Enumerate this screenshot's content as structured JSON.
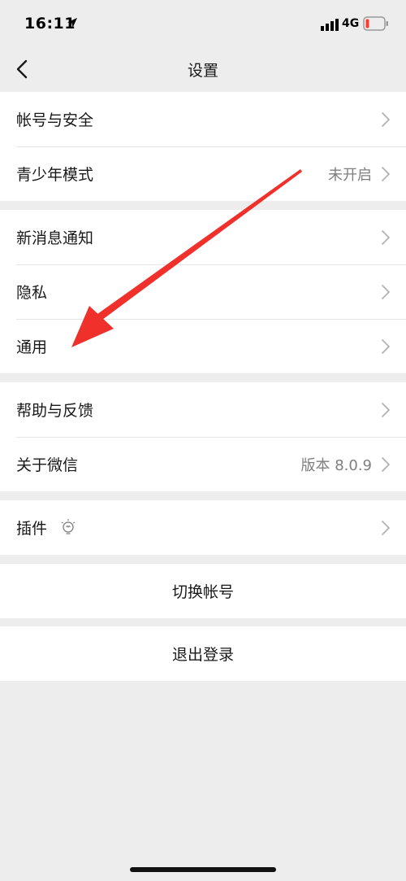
{
  "status_bar": {
    "time": "16:11",
    "network": "4G"
  },
  "nav": {
    "title": "设置"
  },
  "groups": [
    {
      "items": [
        {
          "label": "帐号与安全"
        },
        {
          "label": "青少年模式",
          "value": "未开启"
        }
      ]
    },
    {
      "items": [
        {
          "label": "新消息通知"
        },
        {
          "label": "隐私"
        },
        {
          "label": "通用"
        }
      ]
    },
    {
      "items": [
        {
          "label": "帮助与反馈"
        },
        {
          "label": "关于微信",
          "value": "版本 8.0.9"
        }
      ]
    },
    {
      "items": [
        {
          "label": "插件"
        }
      ]
    }
  ],
  "actions": {
    "switch_account": "切换帐号",
    "logout": "退出登录"
  },
  "colors": {
    "background": "#ededed",
    "annotation_arrow": "#f0302a",
    "battery_low": "#ff3b30"
  },
  "icons": [
    "location-arrow-icon",
    "signal-icon",
    "battery-icon",
    "back-chevron-icon",
    "chevron-right-icon",
    "plugin-bulb-icon"
  ]
}
